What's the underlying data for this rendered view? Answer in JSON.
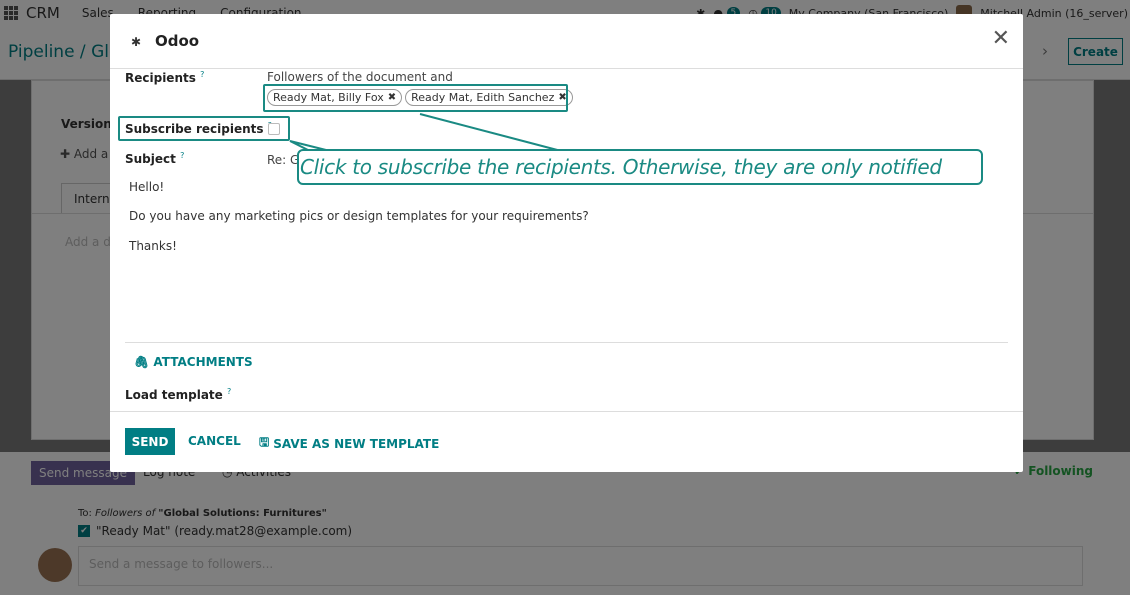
{
  "navbar": {
    "brand": "CRM",
    "menus": [
      "Sales",
      "Reporting",
      "Configuration"
    ],
    "messages_badge": "5",
    "activities_badge": "10",
    "company": "My Company (San Francisco)",
    "user": "Mitchell Admin (16_server)"
  },
  "control_panel": {
    "breadcrumb": "Pipeline / Glo",
    "create_label": "Create"
  },
  "form": {
    "version_label": "Version",
    "add_line_label": "Add a l",
    "internal_tab_label": "Interna",
    "add_description_placeholder": "Add a de"
  },
  "chatter": {
    "send_message_label": "Send message",
    "log_note_label": "Log note",
    "activities_label": "Activities",
    "following_label": "Following",
    "to_prefix": "To:",
    "followers_of": "Followers of",
    "record_name": "\"Global Solutions: Furnitures\"",
    "recipient": "\"Ready Mat\" (ready.mat28@example.com)",
    "message_placeholder": "Send a message to followers..."
  },
  "dialog": {
    "title": "Odoo",
    "recipients_label": "Recipients",
    "followers_text": "Followers of the document and",
    "recipient_tags": [
      "Ready Mat, Billy Fox",
      "Ready Mat, Edith Sanchez"
    ],
    "subscribe_label": "Subscribe recipients",
    "subscribe_checked": false,
    "subject_label": "Subject",
    "subject_value": "Re: G",
    "body_lines": [
      "Hello!",
      "Do you have any marketing pics or design templates for your requirements?",
      "Thanks!"
    ],
    "attachments_label": "ATTACHMENTS",
    "load_template_label": "Load template",
    "send_label": "SEND",
    "cancel_label": "CANCEL",
    "save_template_label": "SAVE AS NEW TEMPLATE"
  },
  "tooltip": {
    "text": "Click to subscribe the recipients. Otherwise, they are only notified"
  },
  "colors": {
    "primary": "#017e84",
    "highlight": "#1a8a83",
    "chatter_button": "#71639e",
    "following": "#28a745"
  }
}
